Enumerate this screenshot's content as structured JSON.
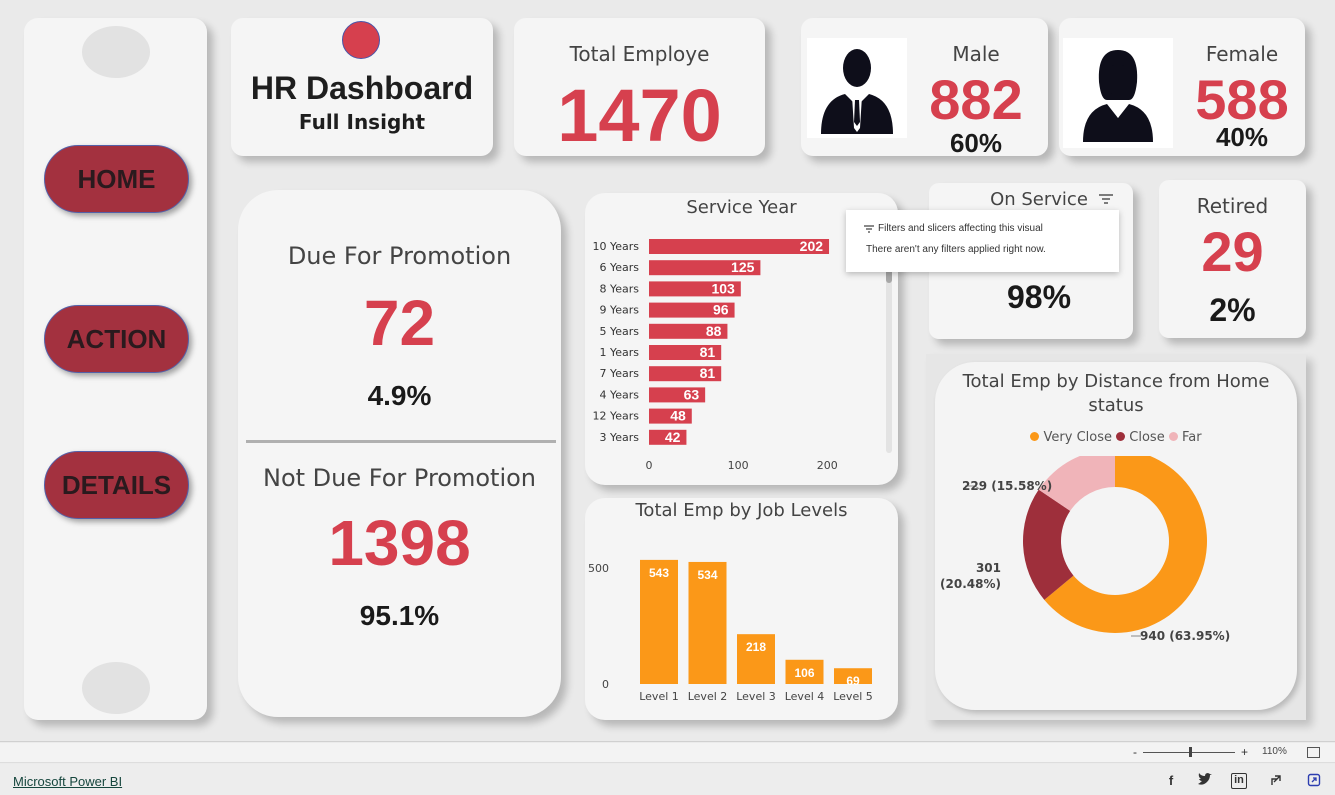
{
  "nav": {
    "buttons": [
      {
        "label": "HOME"
      },
      {
        "label": "ACTION"
      },
      {
        "label": "DETAILS"
      }
    ]
  },
  "header": {
    "title": "HR Dashboard",
    "subtitle": "Full Insight"
  },
  "kpis": {
    "total": {
      "label": "Total Employe",
      "value": "1470"
    },
    "male": {
      "label": "Male",
      "value": "882",
      "pct": "60%"
    },
    "female": {
      "label": "Female",
      "value": "588",
      "pct": "40%"
    },
    "on_service": {
      "label": "On Service",
      "pct": "98%"
    },
    "retired": {
      "label": "Retired",
      "value": "29",
      "pct": "2%"
    }
  },
  "promotion": {
    "due": {
      "label": "Due For Promotion",
      "value": "72",
      "pct": "4.9%"
    },
    "not_due": {
      "label": "Not Due For Promotion",
      "value": "1398",
      "pct": "95.1%"
    }
  },
  "tooltip": {
    "line1": "Filters and slicers affecting this visual",
    "line2": "There aren't any filters applied right now."
  },
  "colors": {
    "accent_red": "#d6404e",
    "nav_red": "#a3313f",
    "orange": "#fb9818",
    "close": "#9e2f3b",
    "far": "#f0b4b9"
  },
  "chart_data": [
    {
      "type": "bar",
      "orientation": "horizontal",
      "title": "Service Year",
      "categories": [
        "10 Years",
        "6 Years",
        "8 Years",
        "9 Years",
        "5 Years",
        "1 Years",
        "7 Years",
        "4 Years",
        "12 Years",
        "3 Years"
      ],
      "values": [
        202,
        125,
        103,
        96,
        88,
        81,
        81,
        63,
        48,
        42
      ],
      "xticks": [
        "0",
        "100",
        "200"
      ],
      "xlim": [
        0,
        230
      ]
    },
    {
      "type": "bar",
      "title": "Total Emp by Job Levels",
      "categories": [
        "Level 1",
        "Level 2",
        "Level 3",
        "Level 4",
        "Level 5"
      ],
      "values": [
        543,
        534,
        218,
        106,
        69
      ],
      "yticks": [
        "500",
        "0"
      ],
      "ylim": [
        0,
        560
      ]
    },
    {
      "type": "pie",
      "title": "Total Emp by Distance from Home status",
      "legend_position": "top",
      "slices": [
        {
          "name": "Very Close",
          "value": 940,
          "label": "940 (63.95%)"
        },
        {
          "name": "Close",
          "value": 301,
          "label": "301 (20.48%)"
        },
        {
          "name": "Far",
          "value": 229,
          "label": "229 (15.58%)"
        }
      ]
    }
  ],
  "statusbar": {
    "zoom": "110%",
    "minus": "-",
    "plus": "+"
  },
  "footer": {
    "link": "Microsoft Power BI"
  }
}
